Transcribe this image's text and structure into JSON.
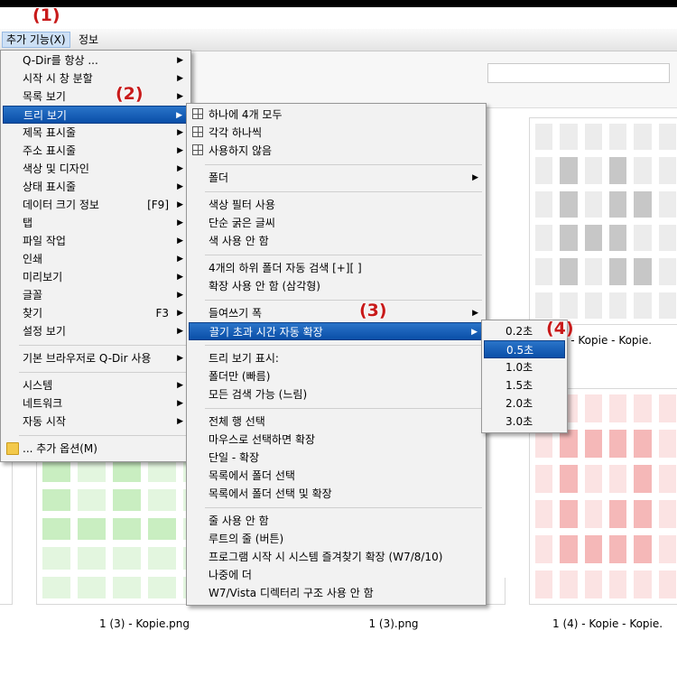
{
  "menubar": {
    "extras": "추가 기능(X)",
    "info": "정보"
  },
  "callouts": [
    "(1)",
    "(2)",
    "(3)",
    "(4)"
  ],
  "menu1": {
    "items": [
      {
        "label": "Q-Dir를 항상 ...",
        "arrow": "▶"
      },
      {
        "label": "시작 시 창 분할",
        "arrow": "▶"
      },
      {
        "label": "목록 보기",
        "arrow": "▶"
      },
      {
        "label": "트리 보기",
        "arrow": "▶"
      },
      {
        "label": "제목 표시줄",
        "arrow": "▶"
      },
      {
        "label": "주소 표시줄",
        "arrow": "▶"
      },
      {
        "label": "색상 및 디자인",
        "arrow": "▶"
      },
      {
        "label": "상태 표시줄",
        "arrow": "▶"
      },
      {
        "label": "데이터 크기 정보",
        "shortcut": "[F9]",
        "arrow": "▶"
      },
      {
        "label": "탭",
        "arrow": "▶"
      },
      {
        "label": "파일 작업",
        "arrow": "▶"
      },
      {
        "label": "인쇄",
        "arrow": "▶"
      },
      {
        "label": "미리보기",
        "arrow": "▶"
      },
      {
        "label": "글꼴",
        "arrow": "▶"
      },
      {
        "label": "찾기",
        "shortcut": "F3",
        "arrow": "▶"
      },
      {
        "label": "설정 보기",
        "arrow": "▶"
      },
      {
        "label": "기본 브라우저로 Q-Dir 사용",
        "arrow": "▶"
      },
      {
        "label": "시스템",
        "arrow": "▶"
      },
      {
        "label": "네트워크",
        "arrow": "▶"
      },
      {
        "label": "자동 시작",
        "arrow": "▶"
      },
      {
        "label": "... 추가 옵션(M)"
      }
    ]
  },
  "menu2": {
    "items": [
      {
        "label": "하나에 4개 모두"
      },
      {
        "label": "각각 하나씩"
      },
      {
        "label": "사용하지 않음"
      },
      {
        "label": "폴더",
        "arrow": "▶"
      },
      {
        "label": "색상 필터 사용"
      },
      {
        "label": "단순 굵은 글씨"
      },
      {
        "label": "색 사용 안 함"
      },
      {
        "label": "4개의 하위 폴더 자동 검색 [+][ ]"
      },
      {
        "label": "확장 사용 안 함 (삼각형)"
      },
      {
        "label": "들여쓰기 폭",
        "arrow": "▶"
      },
      {
        "label": "끌기 초과 시간 자동 확장",
        "arrow": "▶"
      },
      {
        "label": "트리 보기 표시:"
      },
      {
        "label": "폴더만 (빠름)"
      },
      {
        "label": "모든 검색 가능 (느림)"
      },
      {
        "label": "전체 행 선택"
      },
      {
        "label": "마우스로 선택하면 확장"
      },
      {
        "label": "단일 - 확장"
      },
      {
        "label": "목록에서 폴더 선택"
      },
      {
        "label": "목록에서 폴더 선택 및 확장"
      },
      {
        "label": "줄 사용 안 함"
      },
      {
        "label": "루트의 줄 (버튼)"
      },
      {
        "label": "프로그램 시작 시 시스템 즐겨찾기 확장 (W7/8/10)"
      },
      {
        "label": "나중에 더"
      },
      {
        "label": "W7/Vista 디렉터리 구조 사용 안 함"
      }
    ]
  },
  "menu3": {
    "items": [
      {
        "label": "0.2초"
      },
      {
        "label": "0.5초"
      },
      {
        "label": "1.0초"
      },
      {
        "label": "1.5초"
      },
      {
        "label": "2.0초"
      },
      {
        "label": "3.0초"
      }
    ]
  },
  "files": {
    "top_right": "1 (2) - Kopie - Kopie.",
    "bottom_left": "1 (3) - Kopie.png",
    "bottom_mid": "1 (3).png",
    "bottom_right": "1 (4) - Kopie - Kopie."
  },
  "colors": {
    "highlight": "#0a5bb5",
    "callout": "#c81a1a",
    "green_tile": "#c9eec1",
    "red_tile": "#f5b8b8",
    "gray_tile": "#c7c7c7"
  }
}
